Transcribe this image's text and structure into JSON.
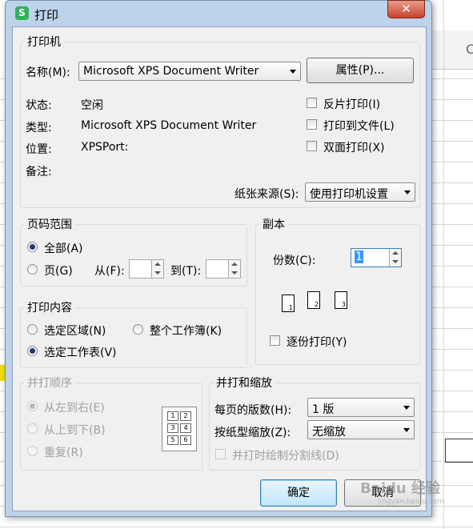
{
  "window": {
    "title": "打印",
    "close_label": "✕",
    "app_icon_label": "S"
  },
  "background": {
    "column_header": "C"
  },
  "printer": {
    "legend": "打印机",
    "name_label": "名称(M):",
    "name_value": "Microsoft XPS Document Writer",
    "properties_button": "属性(P)...",
    "status_label": "状态:",
    "status_value": "空闲",
    "type_label": "类型:",
    "type_value": "Microsoft XPS Document Writer",
    "location_label": "位置:",
    "location_value": "XPSPort:",
    "comment_label": "备注:",
    "reverse_print": "反片打印(I)",
    "print_to_file": "打印到文件(L)",
    "duplex_print": "双面打印(X)",
    "paper_source_label": "纸张来源(S):",
    "paper_source_value": "使用打印机设置"
  },
  "page_range": {
    "legend": "页码范围",
    "all": "全部(A)",
    "pages": "页(G)",
    "from_label": "从(F):",
    "to_label": "到(T):"
  },
  "copies": {
    "legend": "副本",
    "count_label": "份数(C):",
    "count_value": "1",
    "collate": "逐份打印(Y)",
    "page_numbers": [
      "1",
      "2",
      "3"
    ]
  },
  "print_content": {
    "legend": "打印内容",
    "selection": "选定区域(N)",
    "workbook": "整个工作簿(K)",
    "sheet": "选定工作表(V)"
  },
  "print_order": {
    "legend": "并打顺序",
    "left_right": "从左到右(E)",
    "top_bottom": "从上到下(B)",
    "repeat": "重复(R)",
    "preview_cells": [
      "1",
      "2",
      "3",
      "4",
      "5",
      "6"
    ]
  },
  "scaling": {
    "legend": "并打和缩放",
    "pages_per_sheet_label": "每页的版数(H):",
    "pages_per_sheet_value": "1 版",
    "scale_to_paper_label": "按纸型缩放(Z):",
    "scale_to_paper_value": "无缩放",
    "draw_borders": "并打时绘制分割线(D)"
  },
  "buttons": {
    "ok": "确定",
    "cancel": "取消"
  },
  "watermark": {
    "text": "Baidu 经验",
    "url": "jingyan.baidu.com"
  }
}
